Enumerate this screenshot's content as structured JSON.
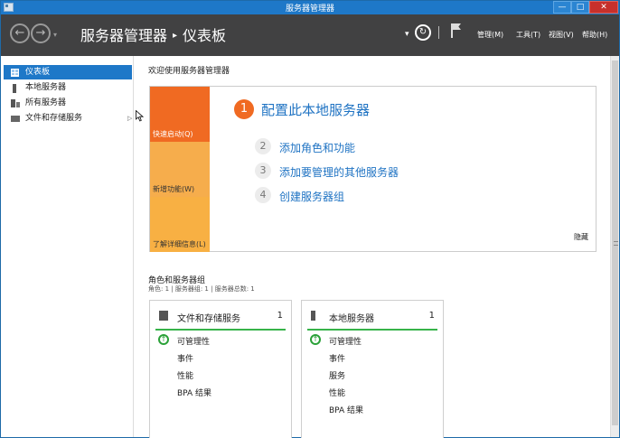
{
  "window": {
    "title": "服务器管理器",
    "minimize": "—",
    "restore": "□",
    "close": "✕"
  },
  "toolbar": {
    "back": "←",
    "forward": "→",
    "dropdown": "▾",
    "breadcrumb_root": "服务器管理器",
    "breadcrumb_sep": "▸",
    "breadcrumb_page": "仪表板",
    "refresh": "↻",
    "dropdown2": "▾",
    "menus": [
      "管理(M)",
      "工具(T)",
      "视图(V)",
      "帮助(H)"
    ]
  },
  "sidebar": {
    "items": [
      {
        "label": "仪表板",
        "icon": "dashboard-icon",
        "active": true
      },
      {
        "label": "本地服务器",
        "icon": "server-icon",
        "active": false
      },
      {
        "label": "所有服务器",
        "icon": "servers-icon",
        "active": false
      },
      {
        "label": "文件和存储服务",
        "icon": "storage-icon",
        "active": false,
        "arrow": "▷"
      }
    ]
  },
  "welcome": {
    "title": "欢迎使用服务器管理器",
    "tiles": [
      "快速启动(Q)",
      "新增功能(W)",
      "了解详细信息(L)"
    ],
    "steps": [
      {
        "num": "1",
        "label": "配置此本地服务器"
      },
      {
        "num": "2",
        "label": "添加角色和功能"
      },
      {
        "num": "3",
        "label": "添加要管理的其他服务器"
      },
      {
        "num": "4",
        "label": "创建服务器组"
      }
    ],
    "hide": "隐藏"
  },
  "roles": {
    "title": "角色和服务器组",
    "subtitle": "角色: 1 | 服务器组: 1 | 服务器总数: 1",
    "cards": [
      {
        "title": "文件和存储服务",
        "count": "1",
        "icon": "storage-icon",
        "rows": [
          "可管理性",
          "事件",
          "性能",
          "BPA 结果"
        ]
      },
      {
        "title": "本地服务器",
        "count": "1",
        "icon": "server-icon",
        "rows": [
          "可管理性",
          "事件",
          "服务",
          "性能",
          "BPA 结果"
        ]
      }
    ],
    "status_icon": "↑"
  },
  "colors": {
    "accent": "#1e78c8",
    "toolbar": "#414142",
    "orange": "#f06a22",
    "yellow": "#f6ad4c",
    "green": "#37b34a"
  }
}
